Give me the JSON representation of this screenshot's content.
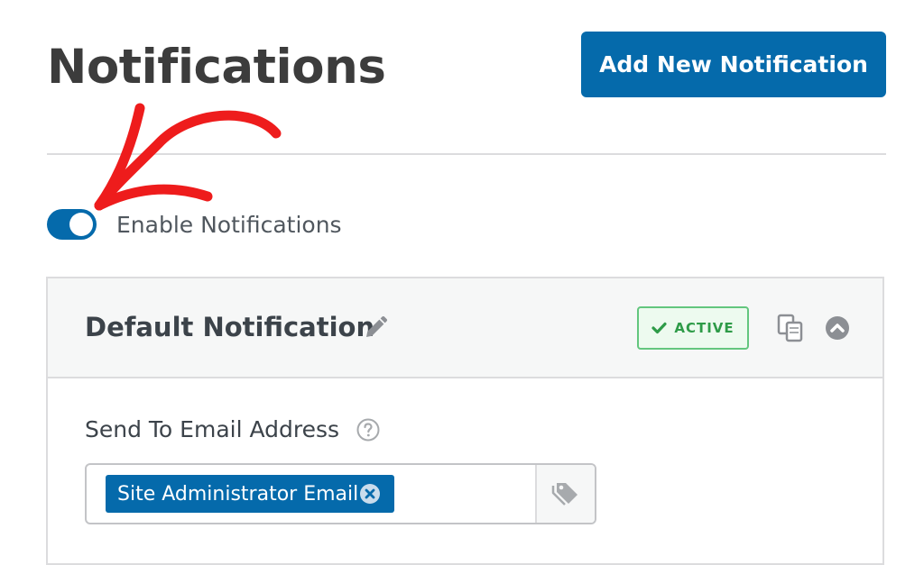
{
  "header": {
    "title": "Notifications",
    "add_button_label": "Add New Notification"
  },
  "toggle": {
    "label": "Enable Notifications",
    "enabled": true
  },
  "notification": {
    "title": "Default Notification",
    "status": "ACTIVE",
    "send_to_label": "Send To Email Address",
    "recipients": [
      "Site Administrator Email"
    ]
  },
  "icons": {
    "edit": "pencil-icon",
    "status_check": "check-icon",
    "clone": "clone-icon",
    "collapse": "chevron-up-circle-icon",
    "help": "question-circle-icon",
    "remove_tag": "close-circle-icon",
    "smart_tags": "tags-icon",
    "annotation": "arrow-annotation"
  },
  "colors": {
    "accent": "#056aab",
    "active_green": "#2e9b48",
    "annotation_red": "#ee1c1c"
  }
}
